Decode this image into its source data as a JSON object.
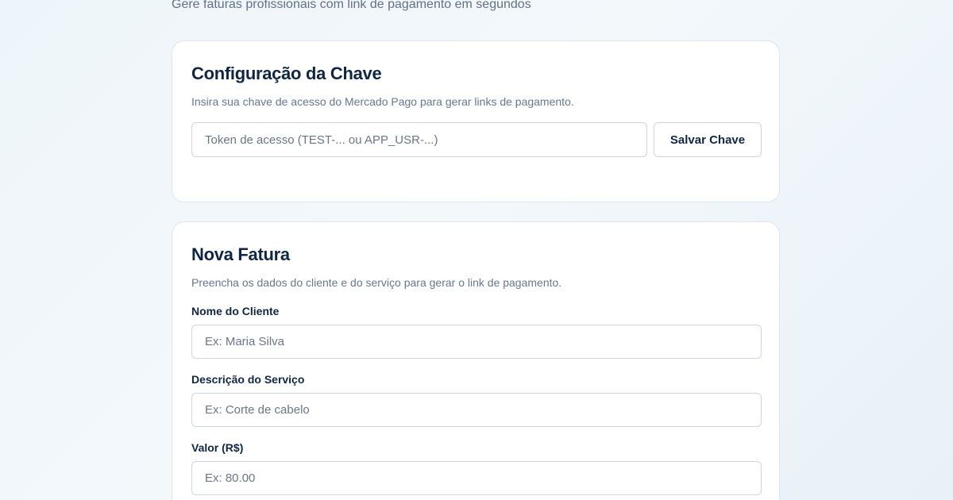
{
  "header": {
    "subtitle": "Gere faturas profissionais com link de pagamento em segundos"
  },
  "key_card": {
    "title": "Configuração da Chave",
    "description": "Insira sua chave de acesso do Mercado Pago para gerar links de pagamento.",
    "token_placeholder": "Token de acesso (TEST-... ou APP_USR-...)",
    "token_value": "",
    "save_label": "Salvar Chave"
  },
  "invoice_card": {
    "title": "Nova Fatura",
    "description": "Preencha os dados do cliente e do serviço para gerar o link de pagamento.",
    "fields": [
      {
        "label": "Nome do Cliente",
        "placeholder": "Ex: Maria Silva",
        "value": ""
      },
      {
        "label": "Descrição do Serviço",
        "placeholder": "Ex: Corte de cabelo",
        "value": ""
      },
      {
        "label": "Valor (R$)",
        "placeholder": "Ex: 80.00",
        "value": ""
      }
    ]
  }
}
